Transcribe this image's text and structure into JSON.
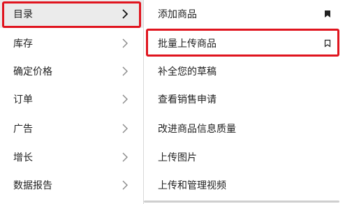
{
  "left_menu": {
    "items": [
      {
        "label": "目录",
        "icon": "chevron-right-icon",
        "active": true
      },
      {
        "label": "库存",
        "icon": "chevron-right-icon"
      },
      {
        "label": "确定价格",
        "icon": "chevron-right-icon"
      },
      {
        "label": "订单",
        "icon": "chevron-right-icon"
      },
      {
        "label": "广告",
        "icon": "chevron-right-icon"
      },
      {
        "label": "增长",
        "icon": "chevron-right-icon"
      },
      {
        "label": "数据报告",
        "icon": "chevron-right-icon"
      }
    ]
  },
  "right_menu": {
    "items": [
      {
        "label": "添加商品",
        "icon": "bookmark-filled-icon"
      },
      {
        "label": "批量上传商品",
        "icon": "bookmark-outline-icon"
      },
      {
        "label": "补全您的草稿"
      },
      {
        "label": "查看销售申请"
      },
      {
        "label": "改进商品信息质量"
      },
      {
        "label": "上传图片"
      },
      {
        "label": "上传和管理视频"
      }
    ]
  },
  "colors": {
    "highlight": "#e0141e",
    "active_background": "#ebebeb",
    "text": "#222222",
    "chevron_active": "#111111",
    "chevron_inactive": "#888888"
  }
}
